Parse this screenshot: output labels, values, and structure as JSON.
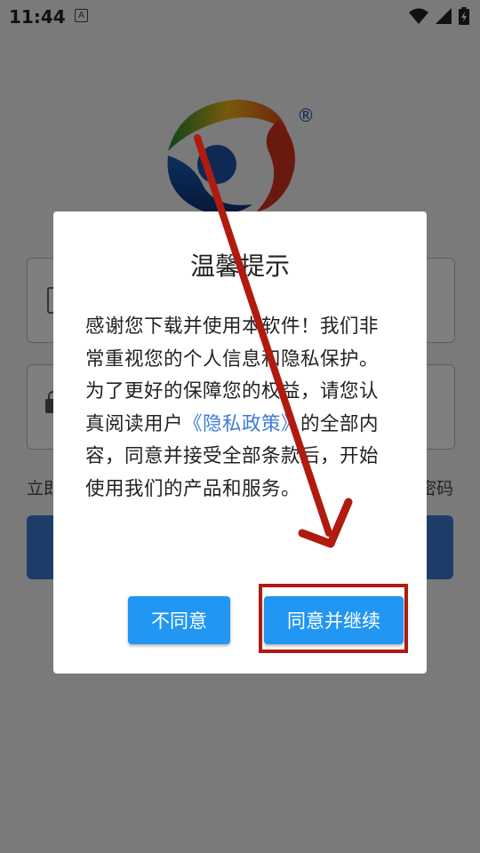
{
  "status_bar": {
    "time": "11:44",
    "notif_letter": "A"
  },
  "background": {
    "logo_mark": "®",
    "forgot_left": "立即",
    "forgot_right": "密码"
  },
  "dialog": {
    "title": "温馨提示",
    "body_before_link": "感谢您下载并使用本软件！我们非常重视您的个人信息和隐私保护。为了更好的保障您的权益，请您认真阅读用户",
    "policy_link": "《隐私政策》",
    "body_after_link": "的全部内容，同意并接受全部条款后，开始使用我们的产品和服务。",
    "disagree_label": "不同意",
    "agree_label": "同意并继续"
  },
  "colors": {
    "button": "#2196f3",
    "link": "#3d7bd8",
    "annotation": "#b01a0f"
  }
}
